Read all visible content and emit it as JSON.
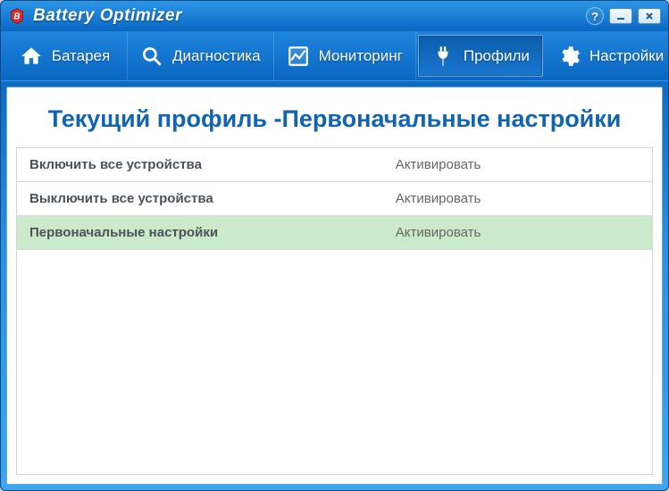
{
  "app": {
    "title": "Battery Optimizer"
  },
  "nav": {
    "items": [
      {
        "label": "Батарея"
      },
      {
        "label": "Диагностика"
      },
      {
        "label": "Мониторинг"
      },
      {
        "label": "Профили"
      },
      {
        "label": "Настройки"
      }
    ],
    "active_index": 3
  },
  "page": {
    "title": "Текущий профиль -Первоначальные настройки"
  },
  "profiles": [
    {
      "name": "Включить все устройства",
      "action": "Активировать",
      "active": false
    },
    {
      "name": "Выключить все устройства",
      "action": "Активировать",
      "active": false
    },
    {
      "name": "Первоначальные настройки",
      "action": "Активировать",
      "active": true
    }
  ]
}
